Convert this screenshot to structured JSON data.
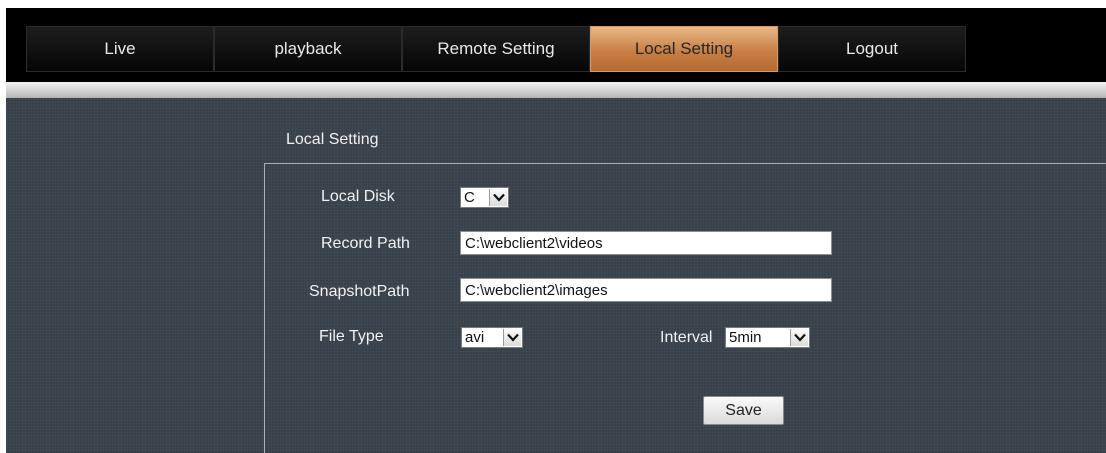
{
  "nav": {
    "tabs": [
      {
        "label": "Live"
      },
      {
        "label": "playback"
      },
      {
        "label": "Remote Setting"
      },
      {
        "label": "Local Setting"
      },
      {
        "label": "Logout"
      }
    ],
    "active_tab": "Local Setting",
    "active_color": "#d38e57"
  },
  "page": {
    "section_title": "Local Setting"
  },
  "form": {
    "local_disk": {
      "label": "Local Disk",
      "value": "C"
    },
    "record_path": {
      "label": "Record Path",
      "value": "C:\\webclient2\\videos"
    },
    "snapshot_path": {
      "label": "SnapshotPath",
      "value": "C:\\webclient2\\images"
    },
    "file_type": {
      "label": "File Type",
      "value": "avi"
    },
    "interval": {
      "label": "Interval",
      "value": "5min"
    },
    "save_label": "Save"
  },
  "icons": {
    "dropdown": "chevron-down-icon"
  },
  "colors": {
    "background": "#38404a",
    "navbar": "#000000",
    "text": "#f2f2f2"
  }
}
